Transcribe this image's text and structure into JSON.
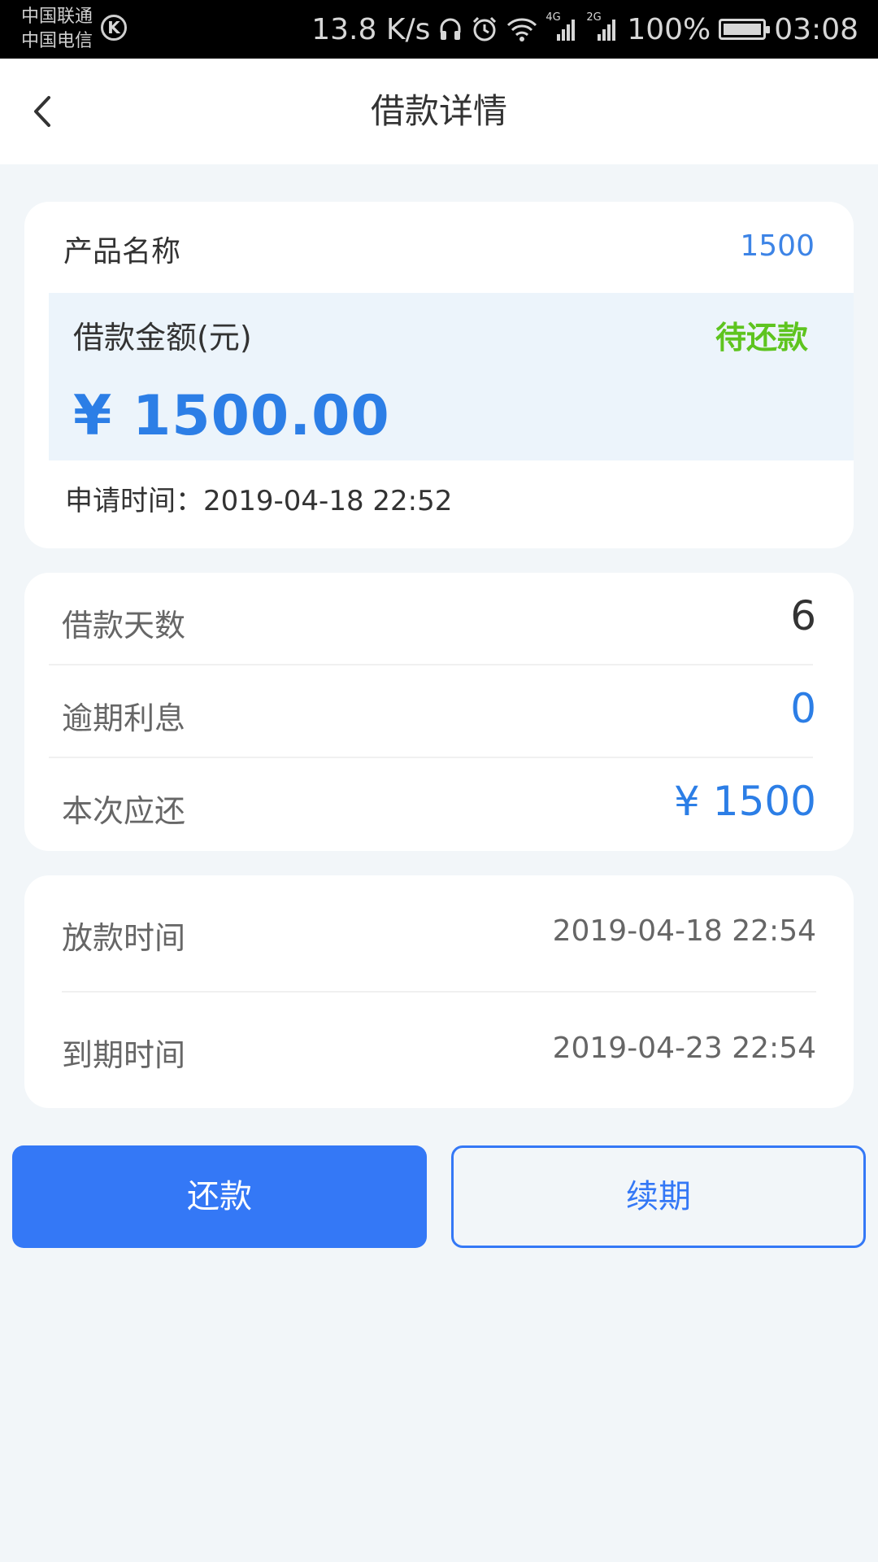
{
  "status_bar": {
    "carrier_line1": "中国联通",
    "carrier_line2": "中国电信",
    "speed": "13.8 K/s",
    "net1": "4G",
    "net2": "2G",
    "battery": "100%",
    "time": "03:08"
  },
  "header": {
    "title": "借款详情"
  },
  "loan": {
    "product_label": "产品名称",
    "product_value": "1500",
    "amount_label": "借款金额(元)",
    "status": "待还款",
    "amount": "¥ 1500.00",
    "apply_line": "申请时间：2019-04-18 22:52"
  },
  "details": [
    {
      "label": "借款天数",
      "value": "6",
      "color": "#333333"
    },
    {
      "label": "逾期利息",
      "value": "0",
      "color": "#2c7ee6"
    },
    {
      "label": "本次应还",
      "value": "¥ 1500",
      "color": "#2c7ee6"
    }
  ],
  "times": [
    {
      "label": "放款时间",
      "value": "2019-04-18 22:54"
    },
    {
      "label": "到期时间",
      "value": "2019-04-23 22:54"
    }
  ],
  "actions": {
    "repay": "还款",
    "renew": "续期"
  },
  "colors": {
    "accent": "#3478f6",
    "status_green": "#5ec41f",
    "background": "#f2f6f9"
  }
}
